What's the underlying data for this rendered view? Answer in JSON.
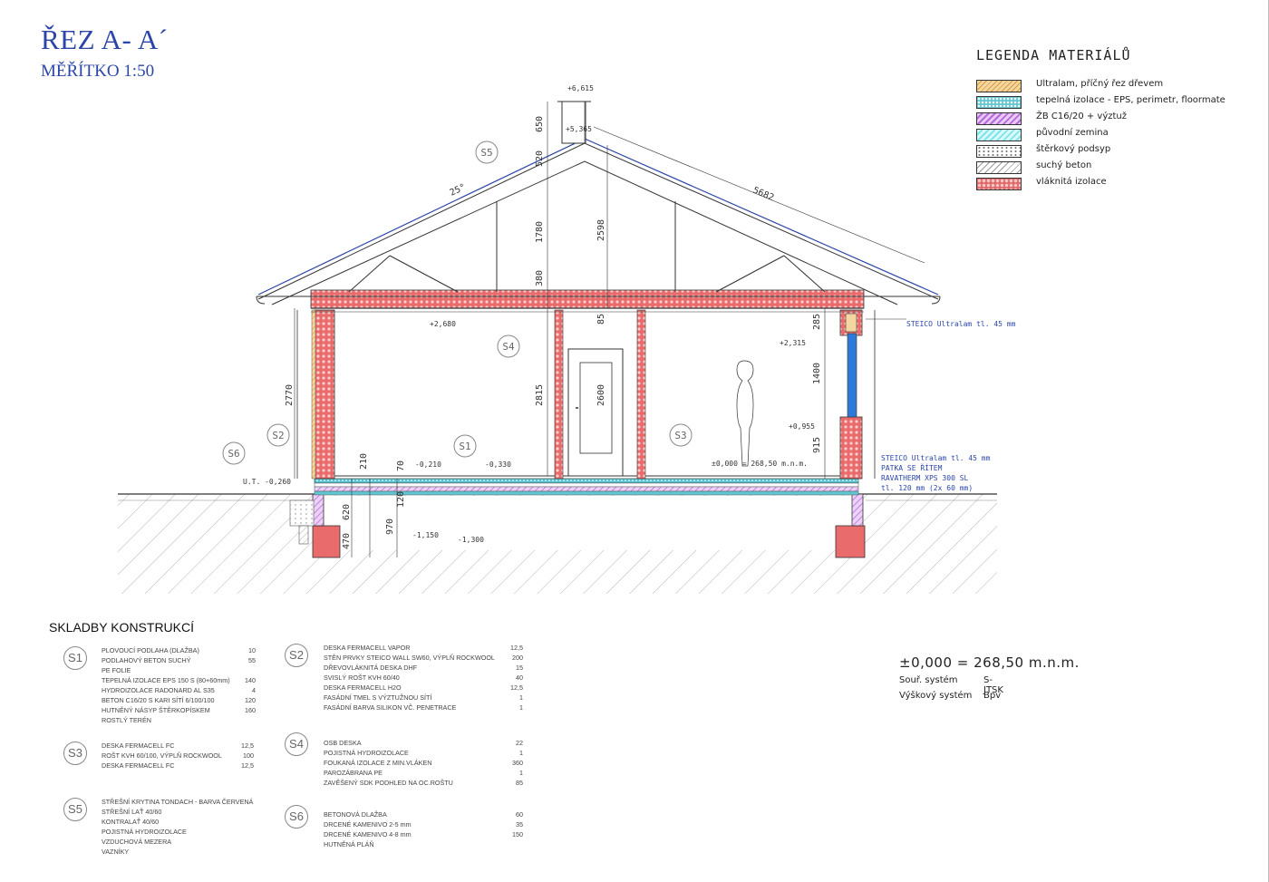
{
  "title": "ŘEZ A- A´",
  "scale": "MĚŘÍTKO 1:50",
  "legend": {
    "title": "LEGENDA MATERIÁLŮ",
    "items": [
      {
        "label": "Ultralam, příčný řez dřevem",
        "color": "#f3d6a0",
        "pattern": "hatch-orange"
      },
      {
        "label": "tepelná izolace - EPS, perimetr, floormate",
        "color": "#5fc6d2",
        "pattern": "dots-cyan"
      },
      {
        "label": "ŽB C16/20 + výztuž",
        "color": "#b46ad8",
        "pattern": "hatch-purple"
      },
      {
        "label": "původní zemina",
        "color": "#7fe3ea",
        "pattern": "hatch-cyan"
      },
      {
        "label": "štěrkový podsyp",
        "color": "#ffffff",
        "pattern": "dots-gray"
      },
      {
        "label": "suchý beton",
        "color": "#ffffff",
        "pattern": "hatch-gray"
      },
      {
        "label": "vláknitá izolace",
        "color": "#e06a6a",
        "pattern": "loops-red"
      }
    ]
  },
  "drawing": {
    "labels": {
      "s1": "S1",
      "s2": "S2",
      "s3": "S3",
      "s4": "S4",
      "s5": "S5",
      "s6": "S6"
    },
    "levels": {
      "top": "+6,615",
      "ridge": "+5,365",
      "ceiling": "+2,680",
      "window_top": "+2,315",
      "window_sill": "+0,955",
      "floor_note": "±0,000 = 268,50 m.n.m.",
      "slab": "-0,210",
      "slab2": "-0,330",
      "terrain": "U.T. -0,260",
      "found1": "-1,150",
      "found2": "-1,300"
    },
    "dims": {
      "d650": "650",
      "d520": "520",
      "d1780": "1780",
      "d380": "380",
      "d2598": "2598",
      "d5682": "5682",
      "d85": "85",
      "d2815": "2815",
      "d2600": "2600",
      "d2770": "2770",
      "d285": "285",
      "d1400": "1400",
      "d915": "915",
      "d210": "210",
      "d70": "70",
      "d120": "120",
      "d620": "620",
      "d470": "470",
      "d970": "970",
      "roof_pitch": "25°"
    },
    "notes": {
      "steico_top": "STEICO Ultralam tl. 45 mm",
      "steico_bot": "STEICO Ultralam tl. 45 mm",
      "patka": "PATKA SE ŘÍTEM",
      "ravatherm": "RAVATHERM XPS 300 SL",
      "ravatherm2": "tl. 120 mm (2x 60 mm)"
    }
  },
  "compositions": {
    "title": "SKLADBY KONSTRUKCÍ",
    "blocks": [
      {
        "id": "S1",
        "items": [
          {
            "name": "PLOVOUCÍ PODLAHA (DLAŽBA)",
            "value": "10"
          },
          {
            "name": "PODLAHOVÝ BETON SUCHÝ",
            "value": "55"
          },
          {
            "name": "PE FOLIE",
            "value": ""
          },
          {
            "name": "TEPELNÁ IZOLACE EPS 150 S (80+60mm)",
            "value": "140"
          },
          {
            "name": "HYDROIZOLACE RADONARD AL S35",
            "value": "4"
          },
          {
            "name": "BETON C16/20 S KARI SÍTÍ 6/100/100",
            "value": "120"
          },
          {
            "name": "HUTNĚNÝ NÁSYP ŠTĚRKOPÍSKEM",
            "value": "160"
          },
          {
            "name": "ROSTLÝ TERÉN",
            "value": ""
          }
        ]
      },
      {
        "id": "S2",
        "items": [
          {
            "name": "DESKA FERMACELL VAPOR",
            "value": "12,5"
          },
          {
            "name": "STĚN PRVKY STEICO WALL SW60, VÝPLŇ ROCKWOOL",
            "value": "200"
          },
          {
            "name": "DŘEVOVLÁKNITÁ DESKA DHF",
            "value": "15"
          },
          {
            "name": "SVISLÝ ROŠT KVH 60/40",
            "value": "40"
          },
          {
            "name": "DESKA FERMACELL H2O",
            "value": "12,5"
          },
          {
            "name": "FASÁDNÍ TMEL S VÝZTUŽNOU SÍTÍ",
            "value": "1"
          },
          {
            "name": "FASÁDNÍ BARVA SILIKON VČ. PENETRACE",
            "value": "1"
          }
        ]
      },
      {
        "id": "S3",
        "items": [
          {
            "name": "DESKA FERMACELL FC",
            "value": "12,5"
          },
          {
            "name": "ROŠT KVH 60/100, VÝPLŇ ROCKWOOL",
            "value": "100"
          },
          {
            "name": "DESKA FERMACELL FC",
            "value": "12,5"
          }
        ]
      },
      {
        "id": "S4",
        "items": [
          {
            "name": "OSB DESKA",
            "value": "22"
          },
          {
            "name": "POJISTNÁ HYDROIZOLACE",
            "value": "1"
          },
          {
            "name": "FOUKANÁ IZOLACE Z MIN.VLÁKEN",
            "value": "360"
          },
          {
            "name": "PAROZÁBRANA PE",
            "value": "1"
          },
          {
            "name": "ZAVĚŠENÝ SDK PODHLED NA OC.ROŠTU",
            "value": "85"
          }
        ]
      },
      {
        "id": "S5",
        "items": [
          {
            "name": "STŘEŠNÍ KRYTINA TONDACH - BARVA ČERVENÁ",
            "value": ""
          },
          {
            "name": "STŘEŠNÍ LAŤ 40/60",
            "value": ""
          },
          {
            "name": "KONTRALAŤ 40/60",
            "value": ""
          },
          {
            "name": "POJISTNÁ HYDROIZOLACE",
            "value": ""
          },
          {
            "name": "VZDUCHOVÁ MEZERA",
            "value": ""
          },
          {
            "name": "VAZNÍKY",
            "value": ""
          }
        ]
      },
      {
        "id": "S6",
        "items": [
          {
            "name": "BETONOVÁ DLAŽBA",
            "value": "60"
          },
          {
            "name": "DRCENÉ KAMENIVO 2-5 mm",
            "value": "35"
          },
          {
            "name": "DRCENÉ KAMENIVO 4-8 mm",
            "value": "150"
          },
          {
            "name": "HUTNĚNÁ PLÁŇ",
            "value": ""
          }
        ]
      }
    ]
  },
  "elevation": {
    "reference": "±0,000  =  268,50  m.n.m.",
    "coord_label": "Souř. systém",
    "coord_value": "S-JTSK",
    "height_label": "Výškový systém",
    "height_value": "Bpv"
  }
}
